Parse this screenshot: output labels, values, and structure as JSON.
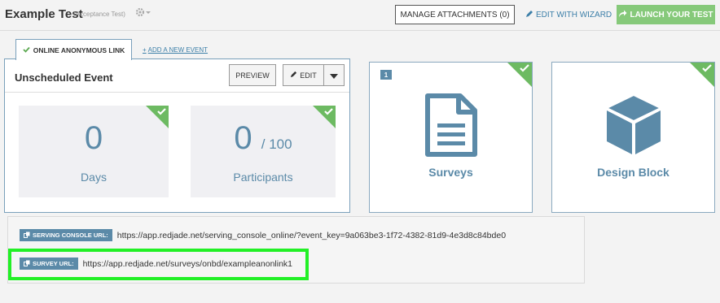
{
  "header": {
    "title": "Example Test",
    "subtitle": "(Acceptance Test)",
    "manage_attachments": "MANAGE ATTACHMENTS (0)",
    "edit_with_wizard": "EDIT WITH WIZARD",
    "launch": "LAUNCH YOUR TEST"
  },
  "tabs": {
    "active": "ONLINE ANONYMOUS LINK",
    "add": "ADD A NEW EVENT"
  },
  "event": {
    "title": "Unscheduled Event",
    "preview": "PREVIEW",
    "edit": "EDIT"
  },
  "stats": {
    "days_value": "0",
    "days_label": "Days",
    "participants_value": "0",
    "participants_total": "/ 100",
    "participants_label": "Participants"
  },
  "tiles": {
    "surveys_badge": "1",
    "surveys_label": "Surveys",
    "design_label": "Design Block"
  },
  "urls": {
    "serving_label": "SERVING CONSOLE URL:",
    "serving_value": "https://app.redjade.net/serving_console_online/?event_key=9a063be3-1f72-4382-81d9-4e3d8c84bde0",
    "survey_label": "SURVEY URL:",
    "survey_value": "https://app.redjade.net/surveys/onbd/exampleanonlink1"
  },
  "colors": {
    "accent": "#5b8aa8",
    "success": "#86c97a",
    "highlight": "#22f026"
  }
}
